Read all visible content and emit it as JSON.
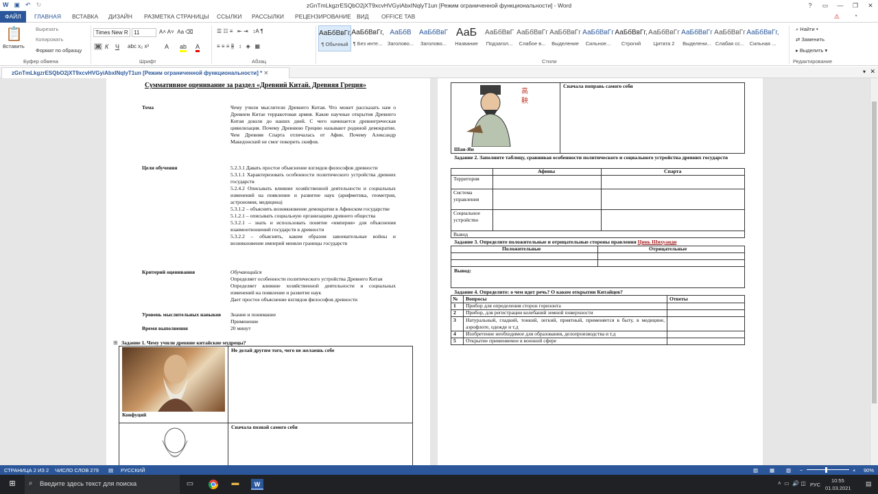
{
  "window": {
    "title": "zGnTmLkgzrESQbO2jXT9xcvHVGyiAbxINqlyT1un [Режим ограниченной функциональности] - Word"
  },
  "tabs": [
    "ФАЙЛ",
    "ГЛАВНАЯ",
    "ВСТАВКА",
    "ДИЗАЙН",
    "РАЗМЕТКА СТРАНИЦЫ",
    "ССЫЛКИ",
    "РАССЫЛКИ",
    "РЕЦЕНЗИРОВАНИЕ",
    "ВИД",
    "OFFICE TAB"
  ],
  "clipboard": {
    "paste": "Вставить",
    "cut": "Вырезать",
    "copy": "Копировать",
    "format": "Формат по образцу",
    "group": "Буфер обмена"
  },
  "font": {
    "name": "Times New R",
    "size": "11",
    "group": "Шрифт"
  },
  "paragraph": {
    "group": "Абзац"
  },
  "styles": {
    "group": "Стили",
    "items": [
      {
        "sample": "АаБбВвГг,",
        "name": "¶ Обычный"
      },
      {
        "sample": "АаБбВвГг,",
        "name": "¶ Без инте..."
      },
      {
        "sample": "АаБбВ",
        "name": "Заголово..."
      },
      {
        "sample": "АаБбВвГ",
        "name": "Заголово..."
      },
      {
        "sample": "АаБ",
        "name": "Название"
      },
      {
        "sample": "АаБбВвГ",
        "name": "Подзагол..."
      },
      {
        "sample": "АаБбВвГг",
        "name": "Слабое в..."
      },
      {
        "sample": "АаБбВвГг",
        "name": "Выделение"
      },
      {
        "sample": "АаБбВвГг",
        "name": "Сильное..."
      },
      {
        "sample": "АаБбВвГг,",
        "name": "Строгий"
      },
      {
        "sample": "АаБбВвГг",
        "name": "Цитата 2"
      },
      {
        "sample": "АаБбВвГг",
        "name": "Выделени..."
      },
      {
        "sample": "АаБбВвГг",
        "name": "Слабая сс..."
      },
      {
        "sample": "АаБбВвГг,",
        "name": "Сильная ..."
      }
    ]
  },
  "editing": {
    "find": "Найти",
    "replace": "Заменить",
    "select": "Выделить",
    "group": "Редактирование"
  },
  "doc_tab": "zGnTmLkgzrESQbO2jXT9xcvHVGyiAbxINqlyT1un [Режим ограниченной функциональности] *",
  "page1": {
    "title": "Суммативное оценивание за раздел «Древний Китай. Древняя Греция»",
    "topic_label": "Тема",
    "topic_text": "Чему учили мыслители Древнего Китая. Что может рассказать нам о Древнем Китае терракотовая армия. Какие научные открытия Древнего Китая дошли до наших дней. С чего начинается древнегреческая цивилизация. Почему Древнюю Грецию называют родиной демократии. Чем Древняя Спарта отличалась от Афин. Почему Александр Македонский не смог покорить скифов.",
    "goals_label": "Цели обучения",
    "goals": [
      "5.2.3.1 Давать простое объяснение взглядов философов древности",
      "5.3.1.1 Характеризовать особенности политического устройства древних государств",
      "5.2.4.2 Описывать влияние хозяйственной деятельности и социальных изменений на появление и развитие наук (арифметика, геометрия, астрономия, медицина)",
      "5.3.1.2 – объяснять возникновение демократии в Афинском государстве",
      "5.1.2.1 – описывать социальную организацию древнего общества",
      "5.3.2.1 – знать и использовать понятие «империя» для объяснения взаимоотношений государств в древности",
      "5.3.2.2 – объяснять, каким образом завоевательные войны и возникновение империй меняли границы государств"
    ],
    "criteria_label": "Критерий оценивания",
    "criteria_head": "Обучающийся",
    "criteria": [
      "Определяет особенности политического устройства Древнего Китая",
      "Определяет влияние хозяйственной деятельности и социальных изменений на появление и развитие наук",
      "Дает простое объяснение взглядов философов древности"
    ],
    "level_label": "Уровень мыслительных навыков",
    "level": [
      "Знание и понимание",
      "Применение"
    ],
    "time_label": "Время выполнения",
    "time": "20 минут",
    "task1": "Задание 1. Чему учили древние китайские мудрецы?",
    "confucius": "Конфуций",
    "quote1": "Не делай другим того, чего не желаешь себе",
    "quote2": "Сначала познай самого себя"
  },
  "page2": {
    "quote3": "Сначала поправь самого себя",
    "shang": "Шан-Ян",
    "task2": "Задание 2. Заполните таблицу, сравнивая особенности политического и социального устройства древних государств",
    "t2_cols": [
      "Афины",
      "Спарта"
    ],
    "t2_rows": [
      "Территория",
      "Система управления",
      "Социальное устройство",
      "Вывод"
    ],
    "task3_prefix": "Задание 3. Определите положительные и отрицательные стороны правления ",
    "task3_name": "Цинь Шихуанди",
    "t3_cols": [
      "Положительные",
      "Отрицательные"
    ],
    "t3_result": "Вывод:",
    "task4": "Задание 4. Определите: о чем идет речь? О каком открытии Китайцев?",
    "t4_cols": [
      "№",
      "Вопросы",
      "Ответы"
    ],
    "t4_rows": [
      {
        "n": "1",
        "q": "Прибор для определения сторон горизонта"
      },
      {
        "n": "2",
        "q": "Прибор, для регистрации колебаний земной поверхности"
      },
      {
        "n": "3",
        "q": "Натуральный, гладкий, тонкий, легкий, приятный, применяется в быту, в медицине, аэрофлоте, одежде и т.д"
      },
      {
        "n": "4",
        "q": "Изобретение необходимое для образования, делопроизводства и т.д"
      },
      {
        "n": "5",
        "q": "Открытие применяемое в военной сфере"
      }
    ]
  },
  "status": {
    "page": "СТРАНИЦА 2 ИЗ 2",
    "words": "ЧИСЛО СЛОВ 279",
    "lang": "РУССКИЙ",
    "zoom": "90%"
  },
  "taskbar": {
    "search": "Введите здесь текст для поиска",
    "lang": "РУС",
    "time": "10:55",
    "date": "01.03.2021"
  }
}
